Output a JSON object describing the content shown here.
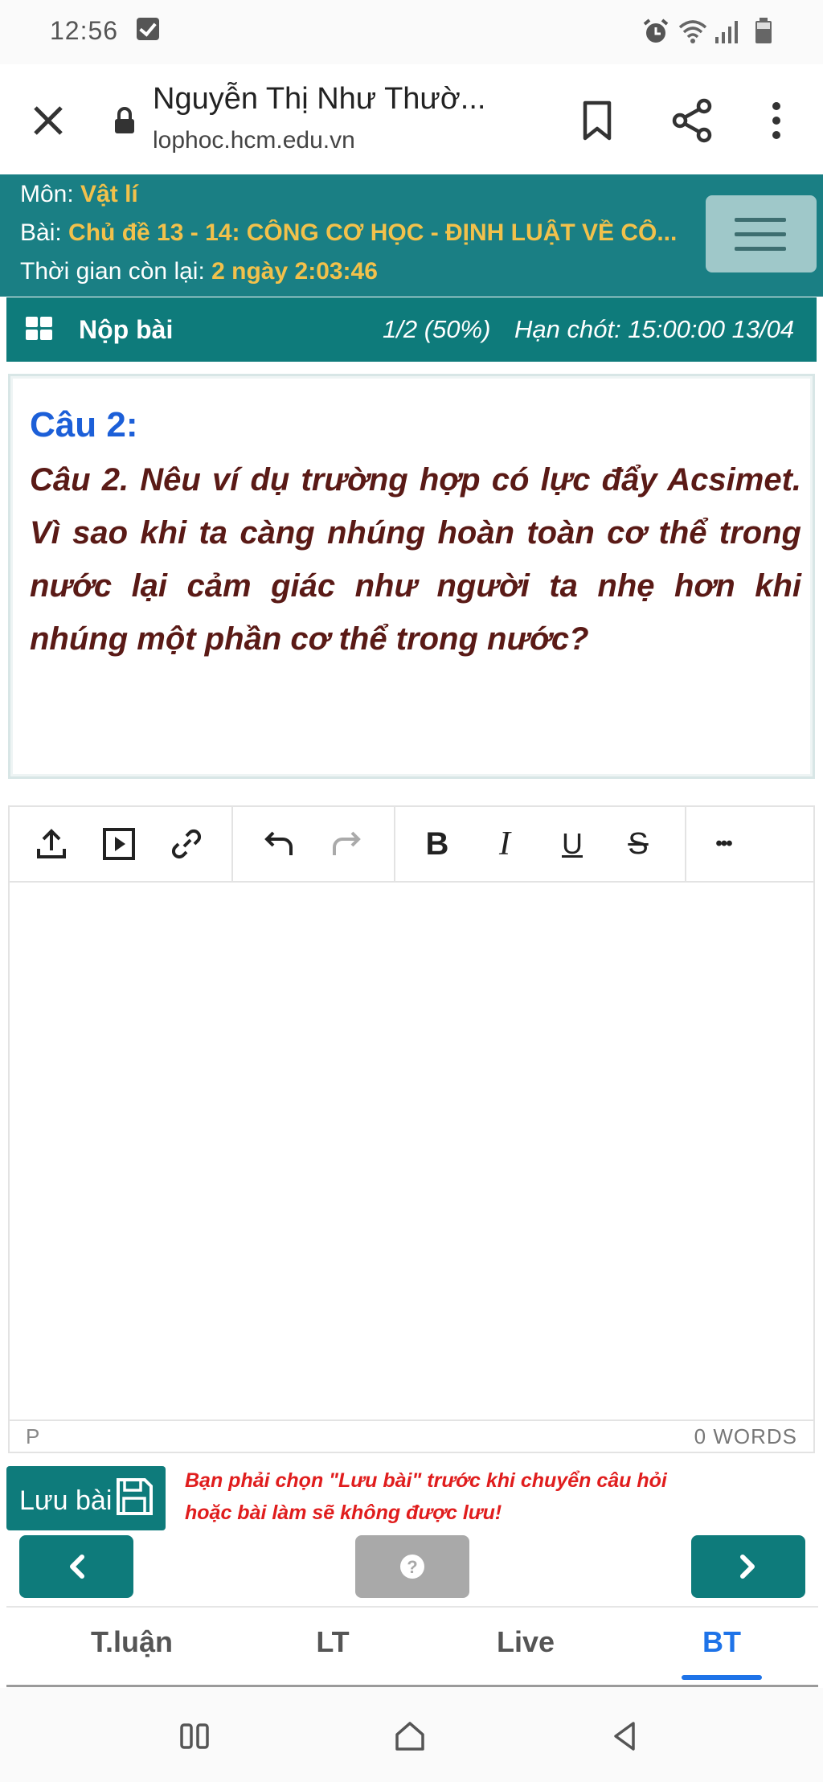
{
  "status_bar": {
    "time": "12:56"
  },
  "browser": {
    "title": "Nguyễn Thị Như Thườ...",
    "url": "lophoc.hcm.edu.vn"
  },
  "info": {
    "subject_label": "Môn:",
    "subject_value": "Vật lí",
    "lesson_label": "Bài:",
    "lesson_value": "Chủ đề 13 - 14: CÔNG CƠ HỌC - ĐỊNH LUẬT VỀ CÔ...",
    "time_label": "Thời gian còn lại:",
    "time_value": "2 ngày 2:03:46"
  },
  "submit_bar": {
    "label": "Nộp bài",
    "progress": "1/2 (50%)",
    "deadline": "Hạn chót: 15:00:00 13/04"
  },
  "question": {
    "heading": "Câu 2:",
    "text": "Câu 2. Nêu ví dụ trường hợp có lực đẩy Acsimet. Vì sao khi ta càng nhúng hoàn toàn cơ thể trong nước lại cảm giác như người ta nhẹ hơn khi nhúng một phần cơ thể trong nước?"
  },
  "editor": {
    "bold": "B",
    "italic": "I",
    "underline": "U",
    "strike": "S",
    "more": "•••",
    "path": "P",
    "word_count": "0 WORDS"
  },
  "save": {
    "label": "Lưu bài",
    "warning_line1": "Bạn phải chọn \"Lưu bài\" trước khi chuyển câu hỏi",
    "warning_line2": "hoặc bài làm sẽ không được lưu!"
  },
  "nav": {
    "prev": "‹",
    "help": "?",
    "next": "›"
  },
  "tabs": [
    {
      "label": "T.luận"
    },
    {
      "label": "LT"
    },
    {
      "label": "Live"
    },
    {
      "label": "BT",
      "active": true
    }
  ],
  "colors": {
    "teal": "#0e7b7b",
    "header": "#1a7f84",
    "accent": "#f2c14b",
    "active_tab": "#1e73e8",
    "question": "#5a1a16",
    "warning": "#e01d1d"
  }
}
